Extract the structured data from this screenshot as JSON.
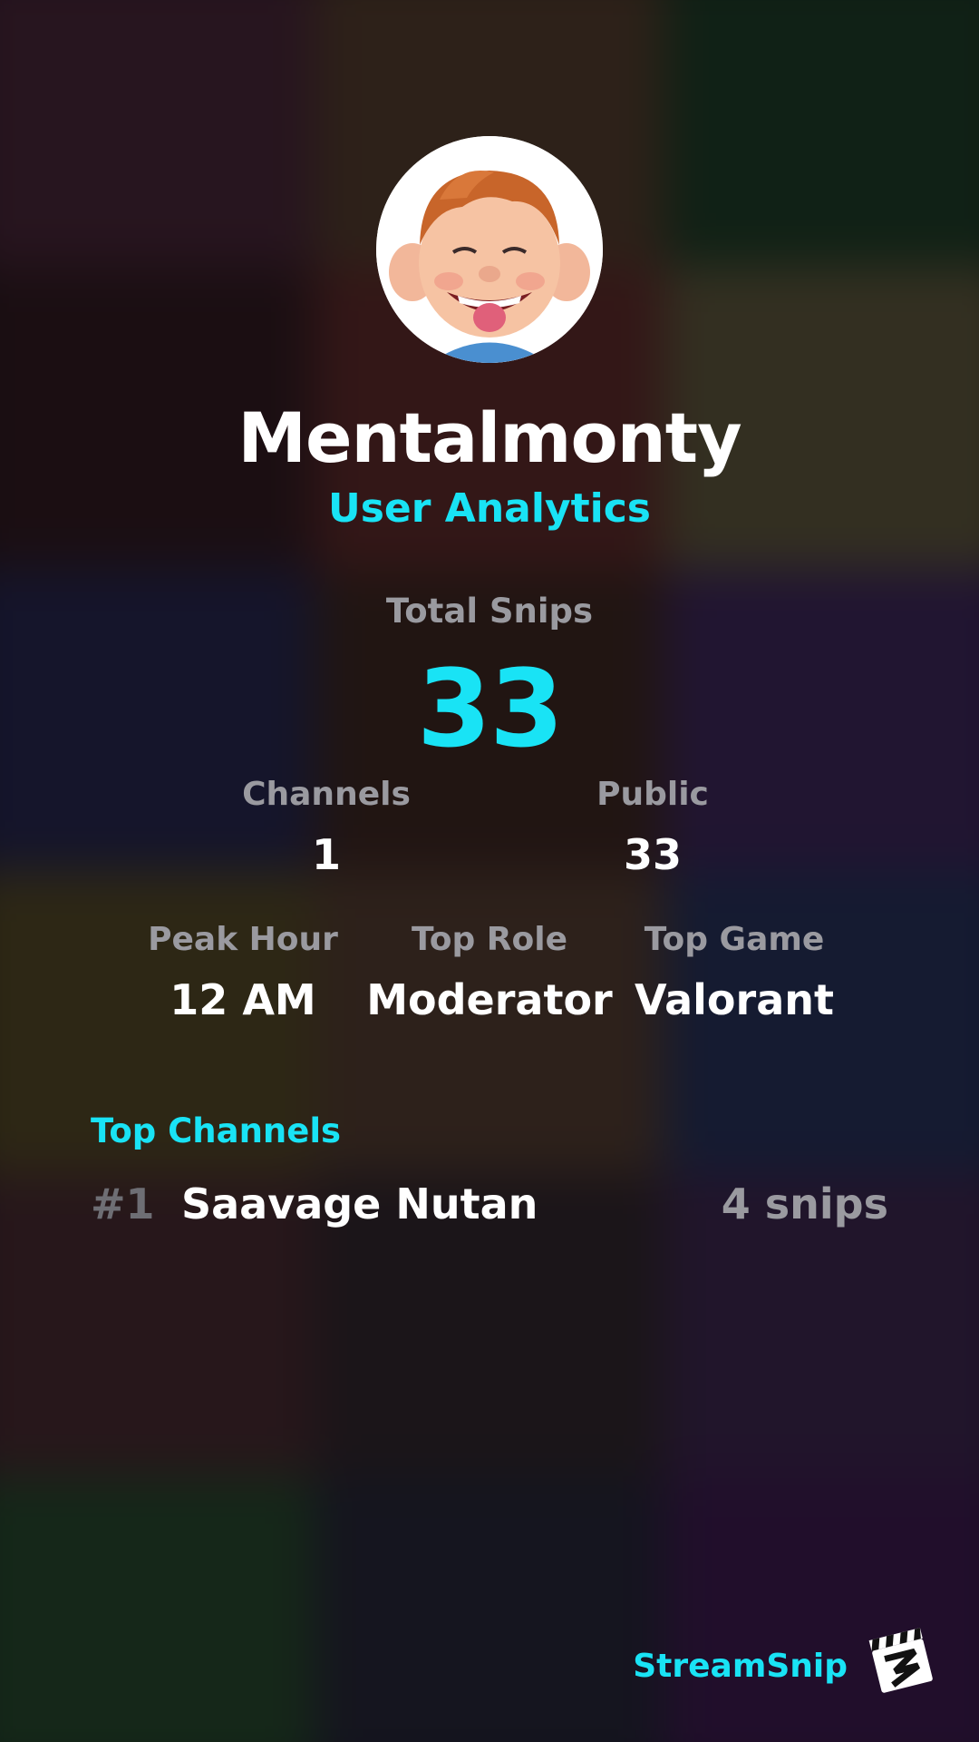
{
  "profile": {
    "username": "Mentalmonty",
    "subtitle": "User Analytics"
  },
  "stats": {
    "total_snips_label": "Total Snips",
    "total_snips_value": "33",
    "channels_label": "Channels",
    "channels_value": "1",
    "public_label": "Public",
    "public_value": "33",
    "peak_hour_label": "Peak Hour",
    "peak_hour_value": "12 AM",
    "top_role_label": "Top Role",
    "top_role_value": "Moderator",
    "top_game_label": "Top Game",
    "top_game_value": "Valorant"
  },
  "top_channels": {
    "title": "Top Channels",
    "items": [
      {
        "rank": "#1",
        "name": "Saavage Nutan",
        "count": "4 snips"
      }
    ]
  },
  "brand": {
    "name": "StreamSnip",
    "logo_icon": "clapperboard-icon"
  },
  "colors": {
    "accent": "#19e3f5",
    "muted": "#9a9aa0",
    "rank": "#6e6e74",
    "text": "#ffffff"
  }
}
